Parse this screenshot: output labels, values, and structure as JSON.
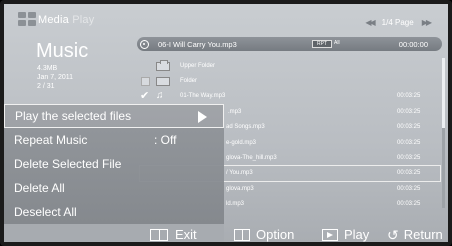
{
  "header": {
    "app_name": "Media",
    "app_name_suffix": "Play",
    "page_indicator": "1/4 Page",
    "prev_arrows": "◀◀",
    "next_arrows": "▶▶"
  },
  "info": {
    "section_title": "Music",
    "size": "4.3MB",
    "date": "Jan 7, 2011",
    "index": "2 / 31"
  },
  "now_playing": {
    "title": "06-I Will Carry You.mp3",
    "repeat_badge": "RPT",
    "repeat_mode": "All",
    "time": "00:00:00"
  },
  "list": {
    "rows": [
      {
        "type": "folder-up",
        "name": "Upper Folder",
        "duration": "",
        "checked": false
      },
      {
        "type": "folder",
        "name": "Folder",
        "duration": "",
        "checked": false
      },
      {
        "type": "music",
        "name": "01-The Way.mp3",
        "duration": "00:03:25",
        "checked": true
      },
      {
        "type": "music",
        "name": ".mp3",
        "duration": "00:03:25",
        "checked": false
      },
      {
        "type": "music",
        "name": "ad Songs.mp3",
        "duration": "00:03:25",
        "checked": false
      },
      {
        "type": "music",
        "name": "e-gold.mp3",
        "duration": "00:03:25",
        "checked": false
      },
      {
        "type": "music",
        "name": "glova-The_hill.mp3",
        "duration": "00:03:25",
        "checked": false
      },
      {
        "type": "music",
        "name": "/ You.mp3",
        "duration": "00:03:25",
        "checked": false
      },
      {
        "type": "music",
        "name": "glova.mp3",
        "duration": "00:03:25",
        "checked": false
      },
      {
        "type": "music",
        "name": "ld.mp3",
        "duration": "00:03:25",
        "checked": false
      }
    ]
  },
  "menu": {
    "items": [
      {
        "label": "Play the selected files",
        "value": "",
        "active": true
      },
      {
        "label": "Repeat Music",
        "value": ": Off",
        "active": false
      },
      {
        "label": "Delete Selected File",
        "value": "",
        "active": false
      },
      {
        "label": "Delete All",
        "value": "",
        "active": false
      },
      {
        "label": "Deselect All",
        "value": "",
        "active": false
      }
    ],
    "exit_label": "Exit"
  },
  "bottom_bar": {
    "option_label": "Option",
    "play_label": "Play",
    "return_label": "Return",
    "return_icon": "↺"
  },
  "colors": {
    "background": "#bfc3c8",
    "menu_background": "#8a8e93",
    "text": "#ffffff"
  }
}
